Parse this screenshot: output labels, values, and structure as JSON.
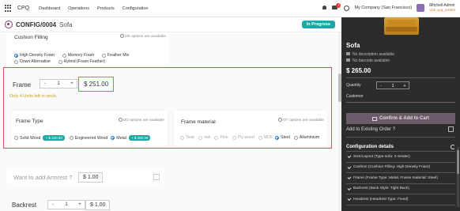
{
  "nav": {
    "brand": "CPQ",
    "menu": [
      "Dashboard",
      "Operations",
      "Products",
      "Configuration"
    ],
    "message_count": "2",
    "company": "My Company (San Francisco)",
    "user_name": "Mitchell Admin",
    "user_db": "v18_cpq_w4984"
  },
  "record": {
    "code": "CONFIG/0004",
    "product": "Sofa",
    "status": "In Progress"
  },
  "cushion": {
    "title": "Cushion Filling",
    "info": "0/5 options are available",
    "options": [
      "High Density Foam",
      "Memory Foam",
      "Feather Mix",
      "Down Alternative",
      "Hybrid (Foam Feather)"
    ]
  },
  "frame": {
    "title": "Frame",
    "qty": "1",
    "minus": "-",
    "plus": "+",
    "price": "$ 251.00",
    "stock_note": "Only 4 Units left in stock."
  },
  "frame_type": {
    "title": "Frame Type",
    "info": "0/3 options are available",
    "options": [
      {
        "label": "Solid Wood",
        "price": "+ $ 200.00"
      },
      {
        "label": "Engineered Wood",
        "price": ""
      },
      {
        "label": "Metal",
        "price": "+ $ 250.00"
      }
    ]
  },
  "frame_material": {
    "title": "Frame material",
    "info": "0/7 options are available",
    "options": [
      "Teak",
      "oak",
      "Pine",
      "Ply wood",
      "MDF",
      "Steel",
      "Alluminium"
    ]
  },
  "armrest": {
    "question": "Want to add Armrest ?",
    "price": "$ 1.00"
  },
  "backrest": {
    "title": "Backrest",
    "qty": "1",
    "minus": "-",
    "plus": "+",
    "price": "$ 1.00"
  },
  "side": {
    "product": "Sofa",
    "no_description": "No description available",
    "no_barcode": "No barcode available",
    "price": "$ 265.00",
    "quantity_label": "Quantity",
    "qty": "1",
    "minus": "-",
    "plus": "+",
    "customer_label": "Customer",
    "confirm_label": "Confirm & Add to Cart",
    "existing_order_label": "Add to Existing Order ?",
    "config_details_title": "Configuration details",
    "config_details": [
      "Size/Layout (Type-sofa: 2-Seater)",
      "Cushion (Cushion Filling: High Density Foam)",
      "Frame (Frame Type: Metal, Frame material: Steel)",
      "Backrest (Back Style: Tight Back)",
      "Headrest (Headrest Type: Fixed)"
    ]
  },
  "colors": {
    "status": "#1fa7a7",
    "highlight_red": "#e05050",
    "highlight_green": "#3ec43e",
    "stock_warning": "#c7a20f",
    "sidebar_bg": "#2c2c2c",
    "confirm_bg": "#6c5c6a"
  },
  "icons": [
    "apps-icon",
    "bell-icon",
    "message-icon",
    "clock-icon",
    "info-icon",
    "check-icon",
    "reset-icon",
    "cart-icon"
  ]
}
